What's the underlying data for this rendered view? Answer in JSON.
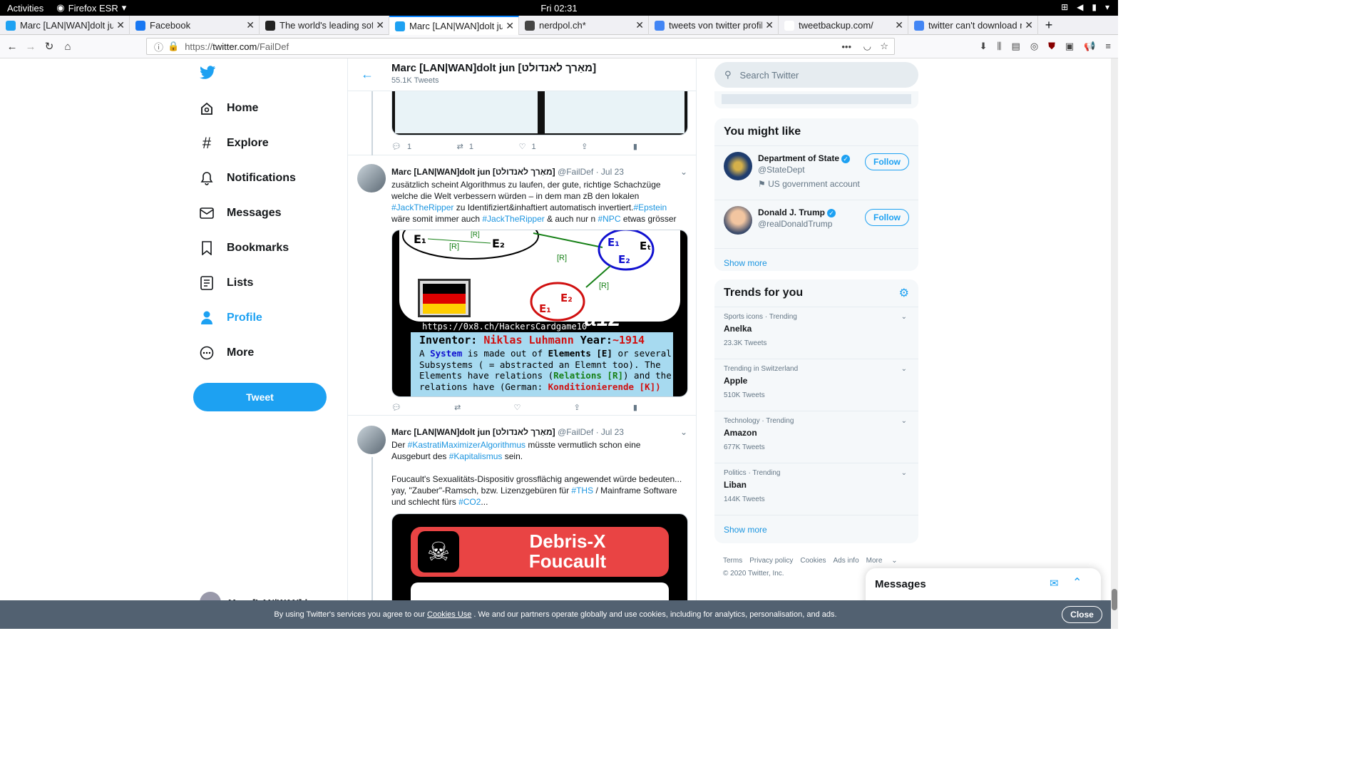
{
  "os": {
    "activities": "Activities",
    "app": "Firefox ESR",
    "clock": "Fri 02:31"
  },
  "tabs": [
    {
      "label": "Marc [LAN|WAN]dolt jun",
      "fav": "twitter-icon",
      "color": "#1da1f2"
    },
    {
      "label": "Facebook",
      "fav": "facebook-icon",
      "color": "#1877f2"
    },
    {
      "label": "The world's leading softw",
      "fav": "github-icon",
      "color": "#222"
    },
    {
      "label": "Marc [LAN|WAN]dolt jun",
      "fav": "twitter-icon",
      "color": "#1da1f2",
      "active": true
    },
    {
      "label": "nerdpol.ch*",
      "fav": "diaspora-icon",
      "color": "#444"
    },
    {
      "label": "tweets von twitter profil",
      "fav": "google-icon",
      "color": "#4285f4"
    },
    {
      "label": "tweetbackup.com/",
      "fav": "",
      "color": "#fff"
    },
    {
      "label": "twitter can't download m",
      "fav": "google-icon",
      "color": "#4285f4"
    }
  ],
  "url": {
    "scheme": "https://",
    "host": "twitter.com",
    "path": "/FailDef"
  },
  "nav": {
    "home": "Home",
    "explore": "Explore",
    "notifications": "Notifications",
    "messages": "Messages",
    "bookmarks": "Bookmarks",
    "lists": "Lists",
    "profile": "Profile",
    "more": "More",
    "tweet": "Tweet",
    "account": "Marc [LAN|WAN]d"
  },
  "header": {
    "name": "Marc [LAN|WAN]dolt jun [מאַרך לאנדולט]",
    "count": "55.1K Tweets"
  },
  "tweet0": {
    "reply": "1",
    "retweet": "1",
    "like": "1"
  },
  "tweet1": {
    "name": "Marc [LAN|WAN]dolt jun [מאַרך לאנדולט]",
    "handle": "@FailDef",
    "date": "Jul 23",
    "l1": "zusätzlich scheint Algorithmus zu laufen, der gute, richtige Schachzüge",
    "l2": "welche die Welt verbessern würden – in dem man zB den lokalen",
    "h1": "#JackTheRipper",
    "l3": " zu Identifiziert&inhaftiert automatisch invertiert.",
    "h2": "#Epstein",
    "l4": "wäre somit immer auch ",
    "h3": "#JackTheRipper",
    "l5": " & auch nur n ",
    "h4": "#NPC",
    "l6": " etwas grösser",
    "card": {
      "url": "https://0x8.ch/HackersCardgame10",
      "tag": "a12",
      "inv_label": "Inventor:",
      "inventor": "Niklas Luhmann",
      "year_label": "Year:",
      "year": "~1914",
      "t1": "A",
      "t2": "System",
      "t3": "is made out of",
      "t4": "Elements [E]",
      "t5": "or several",
      "t6": "Subsystems ( = abstracted an Elemnt too). The",
      "t7": "Elements have relations (",
      "t8": "Relations [R]",
      ") and the": "",
      "t9": ") and the",
      "t10": "relations have (German:",
      "t11": "Konditionierende [K])"
    }
  },
  "tweet2": {
    "name": "Marc [LAN|WAN]dolt jun [מאַרך לאנדולט]",
    "handle": "@FailDef",
    "date": "Jul 23",
    "l1": "Der ",
    "h1": "#KastratiMaximizerAlgorithmus",
    "l2": " müsste vermutlich schon eine",
    "l3": "Ausgeburt des ",
    "h2": "#Kapitalismus",
    "l4": " sein.",
    "l5": "Foucault's Sexualitäts-Dispositiv grossflächig angewendet würde bedeuten...",
    "l6": "yay, \"Zauber\"-Ramsch, bzw. Lizenzgebüren für ",
    "h3": "#THS",
    "l7": " / Mainframe Software",
    "l8": "und schlecht fürs ",
    "h4": "#CO2",
    "l9": "...",
    "card": {
      "title1": "Debris-X",
      "title2": "Foucault"
    }
  },
  "search": {
    "placeholder": "Search Twitter"
  },
  "wtf": {
    "title": "You might like",
    "u1": {
      "name": "Department of State",
      "handle": "@StateDept",
      "label": "US government account"
    },
    "u2": {
      "name": "Donald J. Trump",
      "handle": "@realDonaldTrump"
    },
    "follow": "Follow",
    "more": "Show more"
  },
  "trends": {
    "title": "Trends for you",
    "items": [
      {
        "ctx": "Sports icons · Trending",
        "name": "Anelka",
        "count": "23.3K Tweets"
      },
      {
        "ctx": "Trending in Switzerland",
        "name": "Apple",
        "count": "510K Tweets"
      },
      {
        "ctx": "Technology · Trending",
        "name": "Amazon",
        "count": "677K Tweets"
      },
      {
        "ctx": "Politics · Trending",
        "name": "Liban",
        "count": "144K Tweets"
      }
    ],
    "more": "Show more"
  },
  "footer": {
    "terms": "Terms",
    "privacy": "Privacy policy",
    "cookies": "Cookies",
    "ads": "Ads info",
    "more": "More",
    "copy": "© 2020 Twitter, Inc."
  },
  "dock": {
    "title": "Messages"
  },
  "cookie": {
    "a": "By using Twitter's services you agree to our",
    "link": "Cookies Use",
    "b": ". We and our partners operate globally and use cookies, including for analytics, personalisation, and ads.",
    "close": "Close"
  }
}
